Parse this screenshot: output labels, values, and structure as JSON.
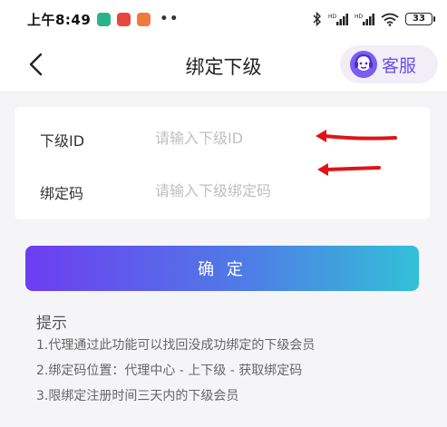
{
  "status_bar": {
    "time": "上午8:49",
    "dots": "••",
    "battery": "33",
    "app_icons": [
      "shield-app-icon",
      "message-app-icon",
      "shop-app-icon"
    ]
  },
  "nav": {
    "title": "绑定下级",
    "back_icon": "chevron-left-icon",
    "service_label": "客服",
    "service_icon": "customer-service-headset-icon"
  },
  "form": {
    "subordinate_id": {
      "label": "下级ID",
      "placeholder": "请输入下级ID",
      "value": ""
    },
    "bind_code": {
      "label": "绑定码",
      "placeholder": "请输入下级绑定码",
      "value": ""
    }
  },
  "confirm_label": "确 定",
  "tips": {
    "title": "提示",
    "items": [
      "1.代理通过此功能可以找回没成功绑定的下级会员",
      "2.绑定码位置：代理中心 - 上下级 - 获取绑定码",
      "3.限绑定注册时间三天内的下级会员"
    ]
  },
  "colors": {
    "accent": "#6a4df0",
    "gradient_start": "#6d3df0",
    "gradient_end": "#33c0d8",
    "annotation_arrow": "#e01414"
  }
}
